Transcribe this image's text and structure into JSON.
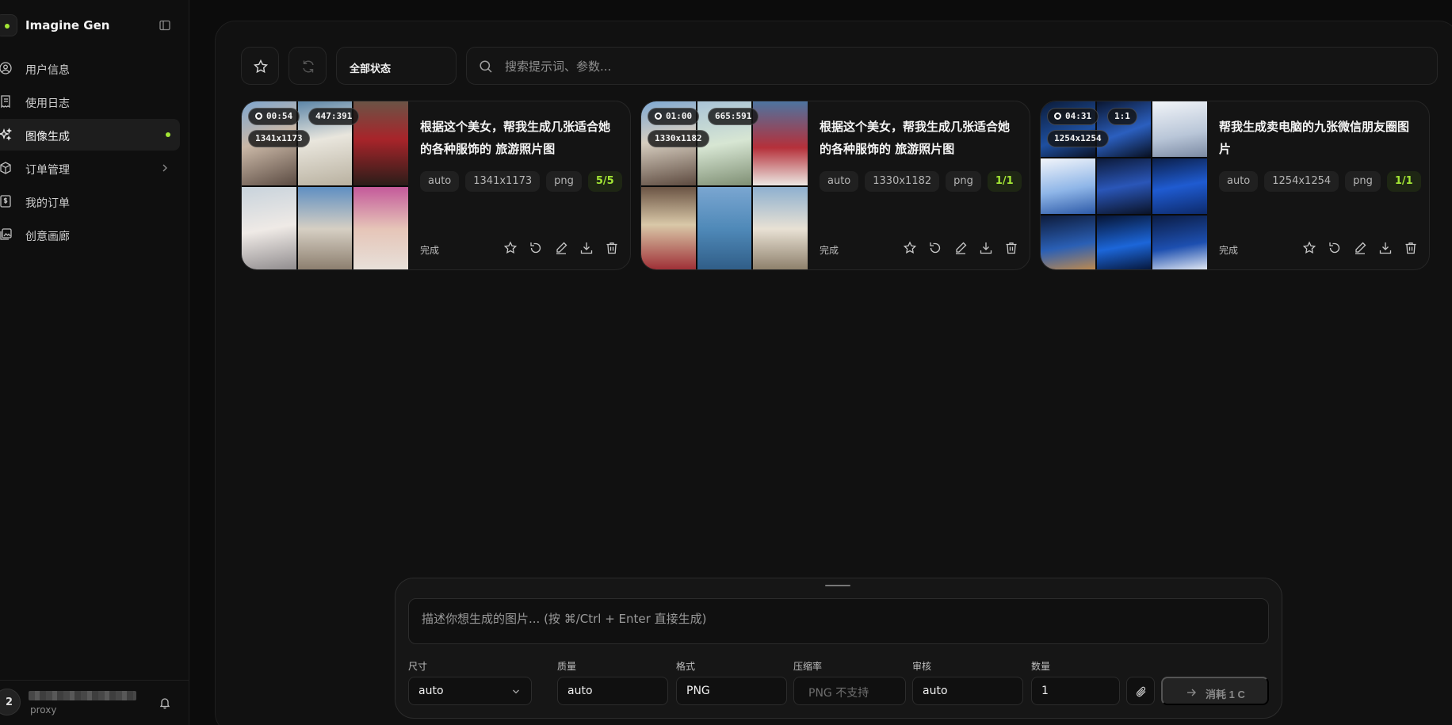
{
  "app": {
    "name": "Imagine Gen"
  },
  "sidebar": {
    "items": [
      {
        "label": "用户信息",
        "icon": "user-circle-icon"
      },
      {
        "label": "使用日志",
        "icon": "receipt-icon"
      },
      {
        "label": "图像生成",
        "icon": "sparkles-icon",
        "active": true
      },
      {
        "label": "订单管理",
        "icon": "box-icon",
        "has_submenu": true
      },
      {
        "label": "我的订单",
        "icon": "dollar-doc-icon"
      },
      {
        "label": "创意画廊",
        "icon": "gallery-icon"
      }
    ],
    "user": {
      "avatar_initial": "2",
      "role": "proxy"
    }
  },
  "toolbar": {
    "status_filter": "全部状态",
    "search_placeholder": "搜索提示词、参数..."
  },
  "cards": [
    {
      "duration": "00:54",
      "ratio": "447:391",
      "size_badge": "1341x1173",
      "title": "根据这个美女，帮我生成几张适合她的各种服饰的 旅游照片图",
      "tags": [
        "auto",
        "1341x1173",
        "png"
      ],
      "count": "5/5",
      "status": "完成"
    },
    {
      "duration": "01:00",
      "ratio": "665:591",
      "size_badge": "1330x1182",
      "title": "根据这个美女，帮我生成几张适合她的各种服饰的 旅游照片图",
      "tags": [
        "auto",
        "1330x1182",
        "png"
      ],
      "count": "1/1",
      "status": "完成"
    },
    {
      "duration": "04:31",
      "ratio": "1:1",
      "size_badge": "1254x1254",
      "title": "帮我生成卖电脑的九张微信朋友圈图片",
      "tags": [
        "auto",
        "1254x1254",
        "png"
      ],
      "count": "1/1",
      "status": "完成"
    }
  ],
  "composer": {
    "placeholder": "描述你想生成的图片... (按 ⌘/Ctrl + Enter 直接生成)",
    "fields": {
      "size": {
        "label": "尺寸",
        "value": "auto"
      },
      "quality": {
        "label": "质量",
        "value": "auto"
      },
      "format": {
        "label": "格式",
        "value": "PNG"
      },
      "compression": {
        "label": "压缩率",
        "value": "PNG 不支持"
      },
      "moderation": {
        "label": "审核",
        "value": "auto"
      },
      "quantity": {
        "label": "数量",
        "value": "1"
      }
    },
    "submit_label": "消耗 1 C"
  },
  "colors": {
    "accent": "#a3e635",
    "background": "#0c0c0c",
    "panel": "#111111"
  }
}
